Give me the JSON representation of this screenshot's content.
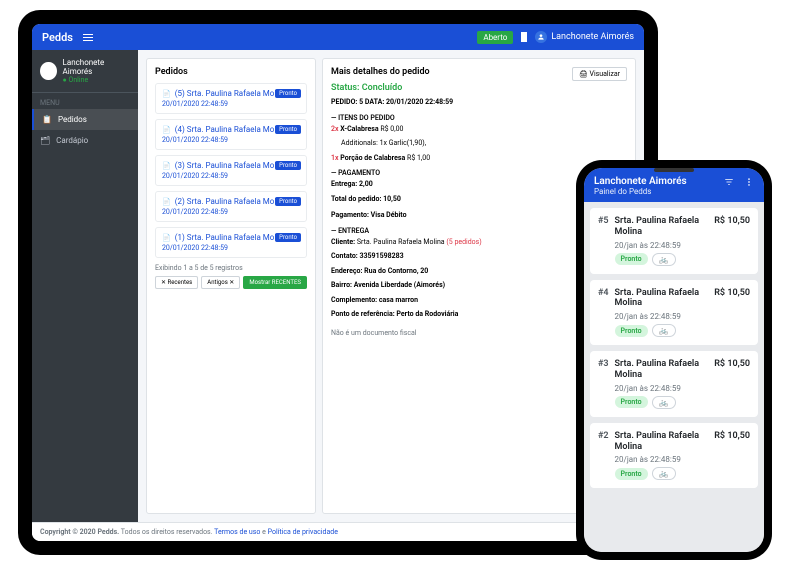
{
  "topbar": {
    "brand": "Pedds",
    "status": "Aberto",
    "user": "Lanchonete Aimorés"
  },
  "sidebar": {
    "user": "Lanchonete Aimorés",
    "status": "Online",
    "menuLabel": "MENU",
    "items": [
      {
        "label": "Pedidos",
        "active": true
      },
      {
        "label": "Cardápio",
        "active": false
      }
    ]
  },
  "orders": {
    "title": "Pedidos",
    "rows": [
      {
        "n": "(5)",
        "name": "Srta. Paulina Rafaela Molina",
        "date": "20/01/2020 22:48:59",
        "badge": "Pronto"
      },
      {
        "n": "(4)",
        "name": "Srta. Paulina Rafaela Molina",
        "date": "20/01/2020 22:48:59",
        "badge": "Pronto"
      },
      {
        "n": "(3)",
        "name": "Srta. Paulina Rafaela Molina",
        "date": "20/01/2020 22:48:59",
        "badge": "Pronto"
      },
      {
        "n": "(2)",
        "name": "Srta. Paulina Rafaela Molina",
        "date": "20/01/2020 22:48:59",
        "badge": "Pronto"
      },
      {
        "n": "(1)",
        "name": "Srta. Paulina Rafaela Molina",
        "date": "20/01/2020 22:48:59",
        "badge": "Pronto"
      }
    ],
    "footer": "Exibindo 1 a 5 de 5 registros",
    "filters": {
      "recentes": "✕ Recentes",
      "antigos": "Antigos ✕",
      "mostrar": "Mostrar RECENTES"
    }
  },
  "detail": {
    "title": "Mais detalhes do pedido",
    "view": "🖨 Visualizar",
    "status": "Status: Concluído",
    "meta": "PEDIDO: 5 DATA: 20/01/2020 22:48:59",
    "sec_itens": "— ITENS DO PEDIDO",
    "it1_qty": "2x",
    "it1_name": "X-Calabresa",
    "it1_price": "R$ 0,00",
    "it1_add": "Additionals: 1x Garlic(1,90),",
    "it2_qty": "1x",
    "it2_name": "Porção de Calabresa",
    "it2_price": "R$ 1,00",
    "sec_pag": "— PAGAMENTO",
    "entrega": "Entrega: 2,00",
    "total": "Total do pedido: 10,50",
    "forma": "Pagamento: Visa Débito",
    "sec_ent": "— ENTREGA",
    "cliente_lbl": "Cliente:",
    "cliente": "Srta. Paulina Rafaela Molina",
    "cliente_cnt": "(5 pedidos)",
    "contato": "Contato: 33591598283",
    "endereco": "Endereço: Rua do Contorno, 20",
    "bairro": "Bairro: Avenida Liberdade (Aimorés)",
    "complemento": "Complemento: casa marron",
    "ref": "Ponto de referência: Perto da Rodoviária",
    "disclaimer": "Não é um documento fiscal"
  },
  "footer": {
    "copy": "Copyright © 2020 Pedds.",
    "rest": " Todos os direitos reservados. ",
    "terms": "Termos de uso",
    "and": " e ",
    "priv": "Política de privacidade"
  },
  "phone": {
    "title": "Lanchonete Aimorés",
    "sub": "Painel do Pedds",
    "cards": [
      {
        "num": "#5",
        "name": "Srta. Paulina Rafaela Molina",
        "date": "20/jan às 22:48:59",
        "status": "Pronto",
        "price": "R$ 10,50"
      },
      {
        "num": "#4",
        "name": "Srta. Paulina Rafaela Molina",
        "date": "20/jan às 22:48:59",
        "status": "Pronto",
        "price": "R$ 10,50"
      },
      {
        "num": "#3",
        "name": "Srta. Paulina Rafaela Molina",
        "date": "20/jan às 22:48:59",
        "status": "Pronto",
        "price": "R$ 10,50"
      },
      {
        "num": "#2",
        "name": "Srta. Paulina Rafaela Molina",
        "date": "20/jan às 22:48:59",
        "status": "Pronto",
        "price": "R$ 10,50"
      }
    ]
  }
}
